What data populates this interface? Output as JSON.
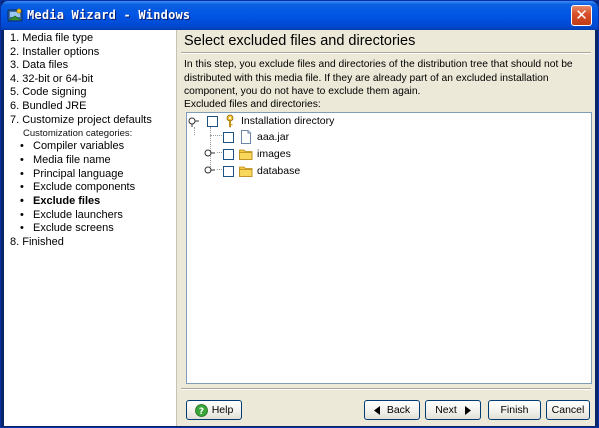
{
  "window": {
    "title": "Media Wizard - Windows",
    "close_glyph": "✕",
    "accent": "#0055e5"
  },
  "steps": {
    "s1": "1. Media file type",
    "s2": "2. Installer options",
    "s3": "3. Data files",
    "s4": "4. 32-bit or 64-bit",
    "s5": "5. Code signing",
    "s6": "6. Bundled JRE",
    "s7": "7. Customize project defaults",
    "categories_header": "Customization categories:",
    "sub": [
      {
        "label": "Compiler variables",
        "active": false
      },
      {
        "label": "Media file name",
        "active": false
      },
      {
        "label": "Principal language",
        "active": false
      },
      {
        "label": "Exclude components",
        "active": false
      },
      {
        "label": "Exclude files",
        "active": true
      },
      {
        "label": "Exclude launchers",
        "active": false
      },
      {
        "label": "Exclude screens",
        "active": false
      }
    ],
    "bullet": "•",
    "s8": "8. Finished"
  },
  "main": {
    "title": "Select excluded files and directories",
    "description": "In this step, you exclude files and directories of the distribution tree that should not be distributed with this media file. If they are already part of an excluded installation component, you do not have to exclude them again.",
    "tree_label": "Excluded files and directories:"
  },
  "tree": {
    "root": {
      "label": "Installation directory",
      "icon": "key-icon",
      "checked": false,
      "expanded": true
    },
    "children": [
      {
        "label": "aaa.jar",
        "icon": "file-icon",
        "checked": false,
        "has_children": false
      },
      {
        "label": "images",
        "icon": "folder-icon",
        "checked": false,
        "has_children": true
      },
      {
        "label": "database",
        "icon": "folder-icon",
        "checked": false,
        "has_children": true
      }
    ]
  },
  "buttons": {
    "help": "Help",
    "back": "Back",
    "next": "Next",
    "finish": "Finish",
    "cancel": "Cancel"
  }
}
